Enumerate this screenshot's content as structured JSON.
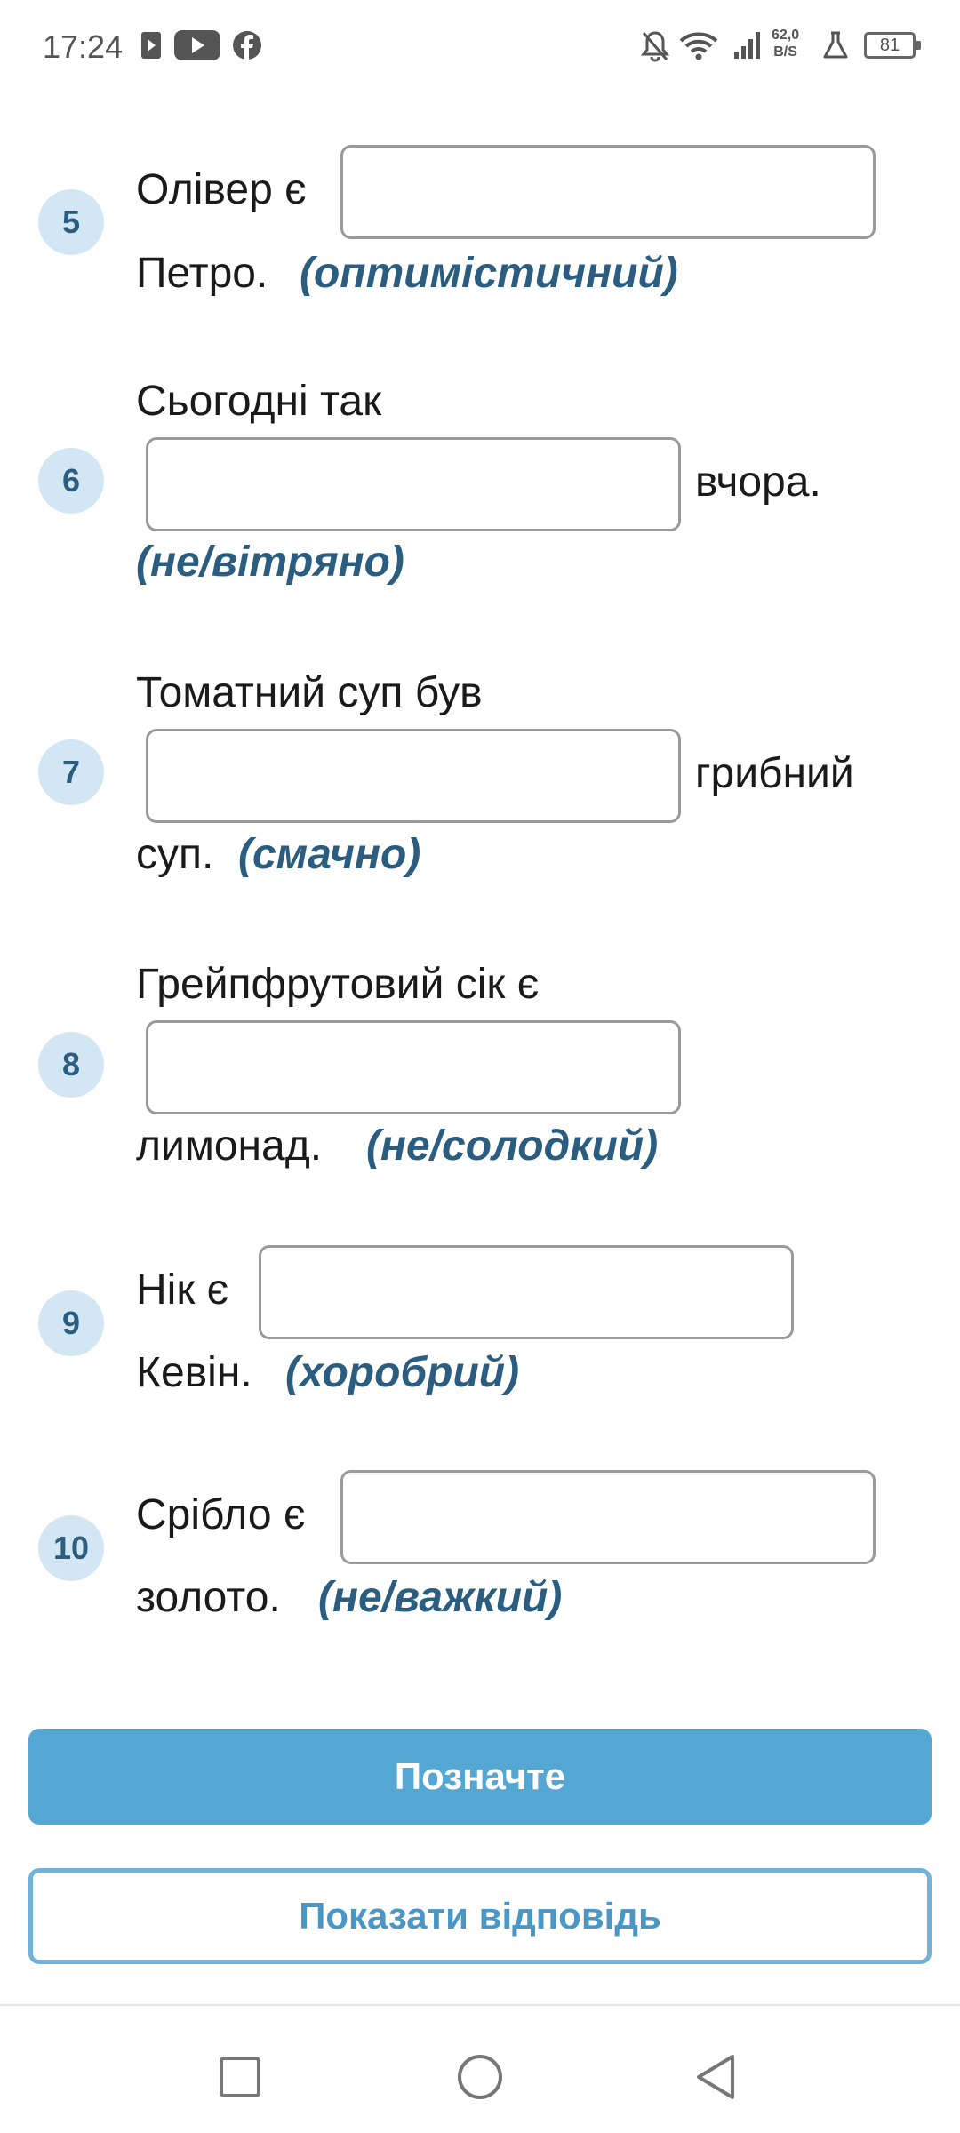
{
  "status_bar": {
    "time": "17:24",
    "network_speed_value": "62,0",
    "network_speed_unit": "B/S",
    "battery": "81",
    "icons": [
      "media-icon",
      "youtube-icon",
      "facebook-icon",
      "notifications-off-icon",
      "wifi-icon",
      "signal-icon",
      "lab-icon",
      "battery-icon"
    ]
  },
  "questions": [
    {
      "number": "5",
      "line1": "Олівер є",
      "line2": "Петро.",
      "hint": "(оптимістичний)"
    },
    {
      "number": "6",
      "line1": "Сьогодні так",
      "after_input": "вчора.",
      "hint": "(не/вітряно)"
    },
    {
      "number": "7",
      "line1": "Томатний суп був",
      "after_input": "грибний",
      "line3": "суп.",
      "hint": "(смачно)"
    },
    {
      "number": "8",
      "line1": "Грейпфрутовий сік є",
      "line3": "лимонад.",
      "hint": "(не/солодкий)"
    },
    {
      "number": "9",
      "line1": "Нік є",
      "line2": "Кевін.",
      "hint": "(хоробрий)"
    },
    {
      "number": "10",
      "line1": "Срібло є",
      "line2": "золото.",
      "hint": "(не/важкий)"
    }
  ],
  "buttons": {
    "check_label": "Позначте",
    "show_answer_label": "Показати відповідь"
  },
  "nav_bar": {
    "items": [
      "recents-square-icon",
      "home-circle-icon",
      "back-triangle-icon"
    ]
  },
  "colors": {
    "accent": "#55a7d3",
    "hint_text": "#2b5d80",
    "badge_bg": "#d3e6f3"
  }
}
